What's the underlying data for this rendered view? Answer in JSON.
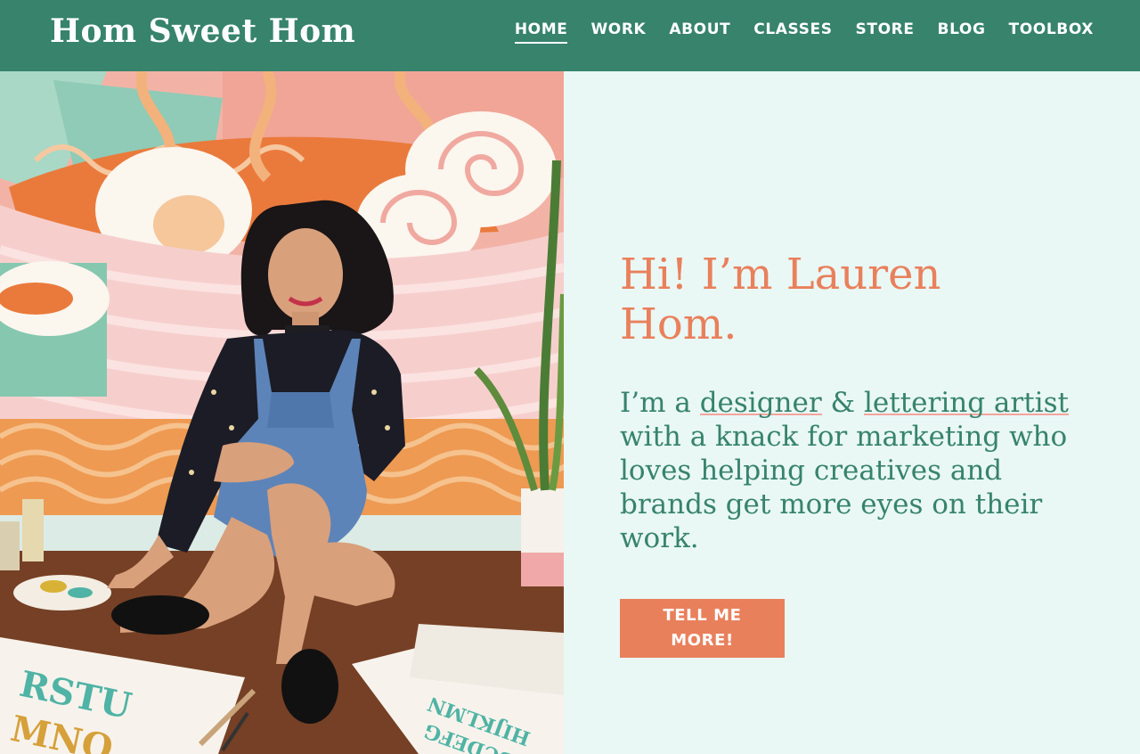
{
  "header": {
    "logo": "Hom Sweet Hom",
    "nav": [
      {
        "label": "HOME",
        "active": true
      },
      {
        "label": "WORK",
        "active": false
      },
      {
        "label": "ABOUT",
        "active": false
      },
      {
        "label": "CLASSES",
        "active": false
      },
      {
        "label": "STORE",
        "active": false
      },
      {
        "label": "BLOG",
        "active": false
      },
      {
        "label": "TOOLBOX",
        "active": false
      }
    ]
  },
  "hero": {
    "headline": "Hi! I’m Lauren Hom.",
    "intro": {
      "p1": "I’m a ",
      "link1": "designer",
      "p2": " & ",
      "link2": "lettering artist",
      "p3": " with a knack for marketing who loves helping creatives and brands get more eyes on their work."
    },
    "cta": "TELL ME MORE!",
    "photo_alt": ""
  },
  "colors": {
    "header_bg": "#37836c",
    "accent": "#e9805c",
    "text_green": "#37836c",
    "panel_bg": "#e9f8f5",
    "underline": "#f3a5a1"
  }
}
